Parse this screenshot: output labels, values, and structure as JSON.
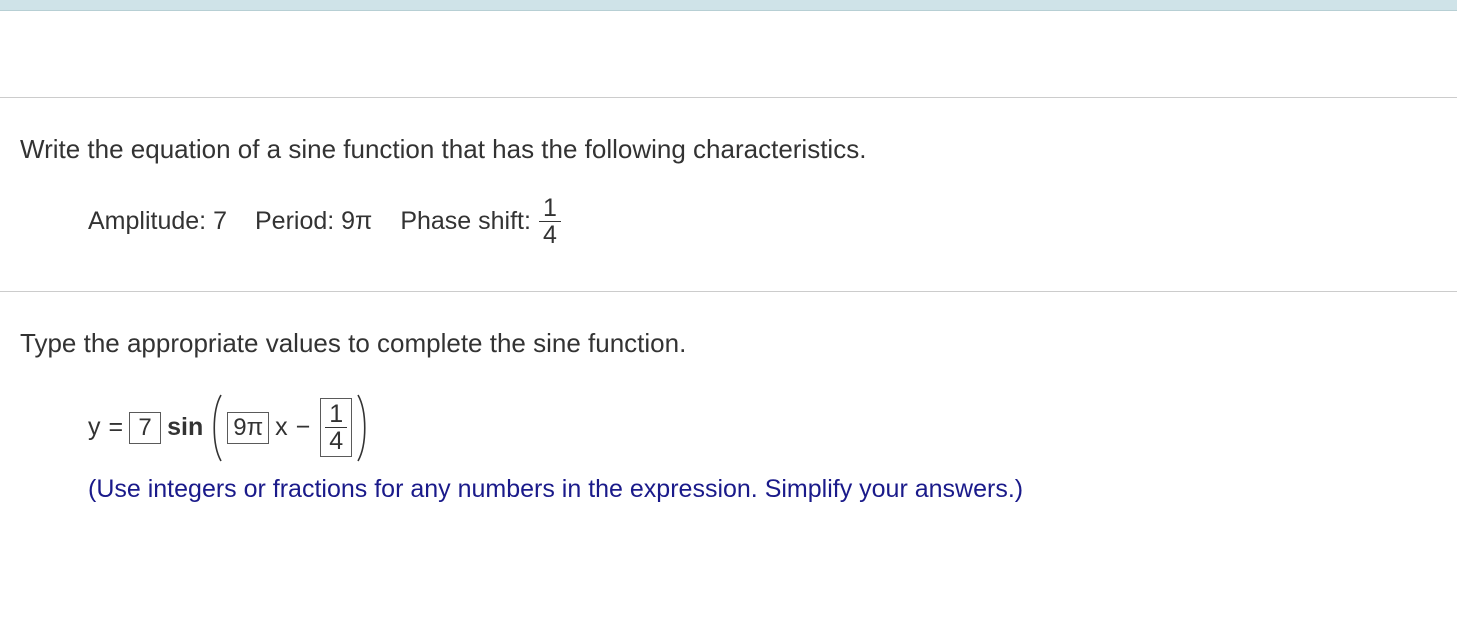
{
  "prompt": "Write the equation of a sine function that has the following characteristics.",
  "given": {
    "amplitude_label": "Amplitude:",
    "amplitude_value": "7",
    "period_label": "Period:",
    "period_value": "9π",
    "phase_label": "Phase shift:",
    "phase_num": "1",
    "phase_den": "4"
  },
  "instruction2": "Type the appropriate values to complete the sine function.",
  "equation": {
    "y": "y",
    "eq": "=",
    "amp_box": "7",
    "sin": "sin",
    "b_box": "9π",
    "x": "x",
    "minus": "−",
    "shift_num": "1",
    "shift_den": "4"
  },
  "hint": "(Use integers or fractions for any numbers in the expression. Simplify your answers.)"
}
